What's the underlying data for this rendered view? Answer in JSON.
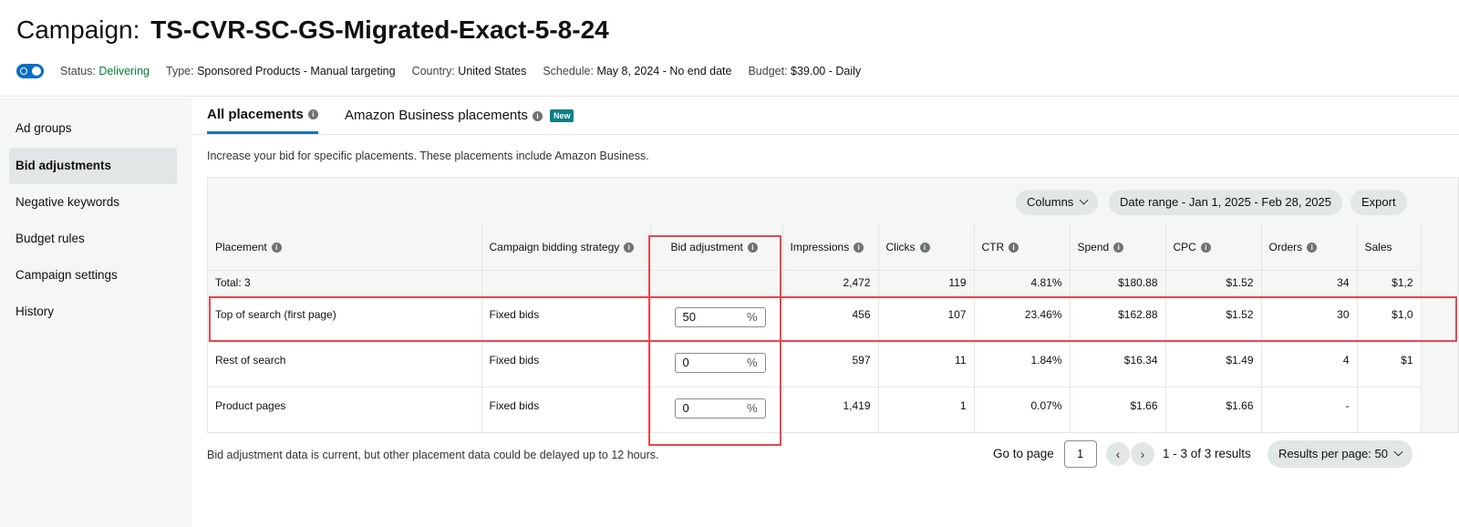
{
  "header": {
    "title_prefix": "Campaign:",
    "title_name": "TS-CVR-SC-GS-Migrated-Exact-5-8-24",
    "status_label": "Status:",
    "status_value": "Delivering",
    "type_label": "Type:",
    "type_value": "Sponsored Products - Manual targeting",
    "country_label": "Country:",
    "country_value": "United States",
    "schedule_label": "Schedule:",
    "schedule_value": "May 8, 2024 - No end date",
    "budget_label": "Budget:",
    "budget_value": "$39.00 - Daily"
  },
  "sidebar": {
    "items": [
      {
        "label": "Ad groups"
      },
      {
        "label": "Bid adjustments"
      },
      {
        "label": "Negative keywords"
      },
      {
        "label": "Budget rules"
      },
      {
        "label": "Campaign settings"
      },
      {
        "label": "History"
      }
    ]
  },
  "tabs": {
    "all": "All placements",
    "business": "Amazon Business placements",
    "new_badge": "New"
  },
  "description": "Increase your bid for specific placements. These placements include Amazon Business.",
  "toolbar": {
    "columns": "Columns",
    "date_range": "Date range - Jan 1, 2025 - Feb 28, 2025",
    "export": "Export"
  },
  "table": {
    "headers": [
      "Placement",
      "Campaign bidding strategy",
      "Bid adjustment",
      "Impressions",
      "Clicks",
      "CTR",
      "Spend",
      "CPC",
      "Orders",
      "Sales"
    ],
    "total": {
      "label": "Total: 3",
      "impressions": "2,472",
      "clicks": "119",
      "ctr": "4.81%",
      "spend": "$180.88",
      "cpc": "$1.52",
      "orders": "34",
      "sales": "$1,2"
    },
    "rows": [
      {
        "placement": "Top of search (first page)",
        "strategy": "Fixed bids",
        "bid": "50",
        "impressions": "456",
        "clicks": "107",
        "ctr": "23.46%",
        "spend": "$162.88",
        "cpc": "$1.52",
        "orders": "30",
        "sales": "$1,0"
      },
      {
        "placement": "Rest of search",
        "strategy": "Fixed bids",
        "bid": "0",
        "impressions": "597",
        "clicks": "11",
        "ctr": "1.84%",
        "spend": "$16.34",
        "cpc": "$1.49",
        "orders": "4",
        "sales": "$1"
      },
      {
        "placement": "Product pages",
        "strategy": "Fixed bids",
        "bid": "0",
        "impressions": "1,419",
        "clicks": "1",
        "ctr": "0.07%",
        "spend": "$1.66",
        "cpc": "$1.66",
        "orders": "-",
        "sales": ""
      }
    ],
    "pct_symbol": "%"
  },
  "footer": {
    "note": "Bid adjustment data is current, but other placement data could be delayed up to 12 hours.",
    "go_to_page": "Go to page",
    "page_value": "1",
    "results": "1 - 3 of 3 results",
    "results_per_page": "Results per page: 50"
  },
  "colors": {
    "accent": "#0b6ec3",
    "status_green": "#067d3a",
    "highlight_red": "#e8474a",
    "new_badge": "#0b7f86"
  }
}
